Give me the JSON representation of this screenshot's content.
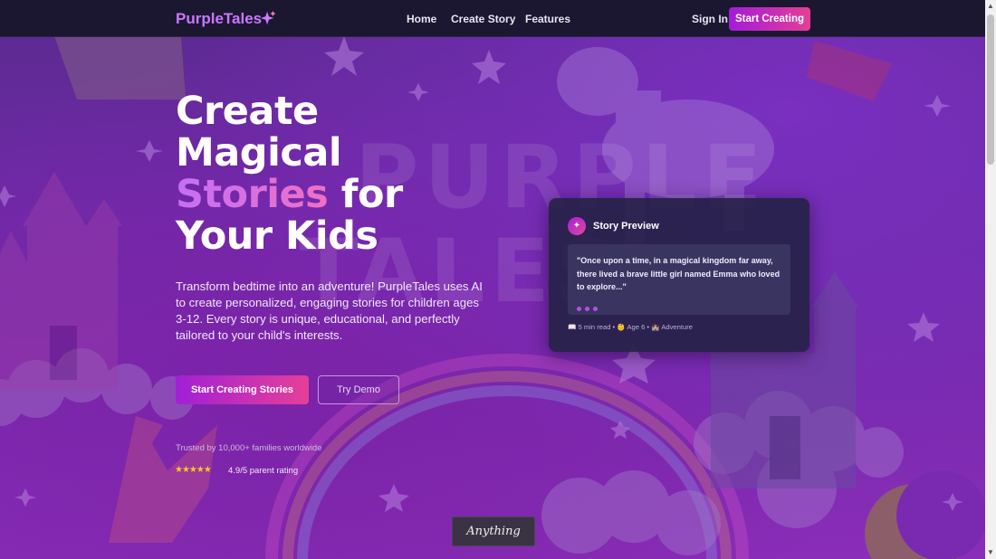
{
  "nav": {
    "brand": "PurpleTales",
    "brand_icon": "sparkles-icon",
    "links": [
      "Home",
      "Create Story",
      "Features"
    ],
    "sign_in": "Sign In",
    "cta": "Start Creating"
  },
  "hero": {
    "title_line1": "Create",
    "title_line2": "Magical",
    "title_accent": "Stories",
    "title_line3_rest": " for",
    "title_line4": "Your Kids",
    "description": "Transform bedtime into an adventure! PurpleTales uses AI to create personalized, engaging stories for children ages 3-12. Every story is unique, educational, and perfectly tailored to your child's interests.",
    "primary_button": "Start Creating Stories",
    "secondary_button": "Try Demo",
    "trusted": "Trusted by 10,000+ families worldwide",
    "stars": "★★★★★",
    "rating": "4.9/5 parent rating"
  },
  "preview": {
    "icon": "sparkles-icon",
    "title": "Story Preview",
    "quote": "\"Once upon a time, in a magical kingdom far away, there lived a brave little girl named Emma who loved to explore...\"",
    "meta": "📖 5 min read • 👶 Age 6 • 🏰 Adventure"
  },
  "background": {
    "watermark_top": "PURPLE",
    "watermark_bottom": "TALES"
  },
  "badge": {
    "label": "Anything"
  },
  "colors": {
    "accent_start": "#a21cd8",
    "accent_end": "#e63e96",
    "brand": "#c779ff",
    "nav_bg": "#1c1730"
  }
}
